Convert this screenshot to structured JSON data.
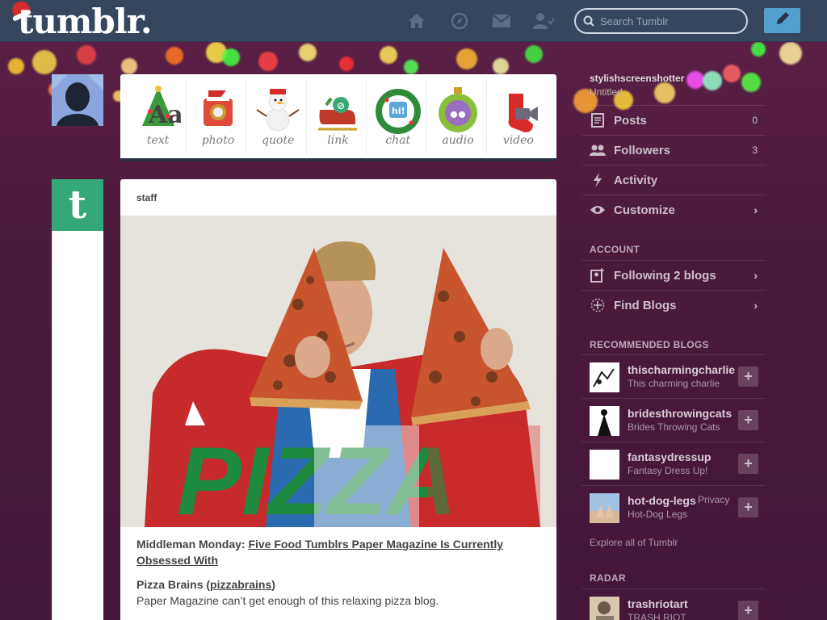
{
  "header": {
    "logo": "tumblr.",
    "search_placeholder": "Search Tumblr",
    "icons": [
      "home-icon",
      "explore-icon",
      "inbox-icon",
      "account-icon"
    ]
  },
  "composer": {
    "items": [
      {
        "label": "text",
        "icon": "christmas-tree-text-icon"
      },
      {
        "label": "photo",
        "icon": "santa-camera-icon"
      },
      {
        "label": "quote",
        "icon": "snowman-quote-icon"
      },
      {
        "label": "link",
        "icon": "sleigh-link-icon"
      },
      {
        "label": "chat",
        "icon": "wreath-chat-icon"
      },
      {
        "label": "audio",
        "icon": "ornament-audio-icon"
      },
      {
        "label": "video",
        "icon": "stocking-video-icon"
      }
    ]
  },
  "post": {
    "author": "staff",
    "image_text": "PIZZA",
    "headline_prefix": "Middleman Monday: ",
    "headline_link": "Five Food Tumblrs Paper Magazine Is Currently Obsessed With",
    "sub_title": "Pizza Brains (",
    "sub_link": "pizzabrains",
    "sub_close": ")",
    "sub_desc": "Paper Magazine can’t get enough of this relaxing pizza blog."
  },
  "sidebar": {
    "blog_name": "stylishscreenshotter",
    "blog_title": "Untitled",
    "rows": [
      {
        "label": "Posts",
        "count": "0"
      },
      {
        "label": "Followers",
        "count": "3"
      },
      {
        "label": "Activity",
        "count": ""
      },
      {
        "label": "Customize",
        "count": ""
      }
    ],
    "account_head": "ACCOUNT",
    "account_rows": [
      {
        "label": "Following 2 blogs"
      },
      {
        "label": "Find Blogs"
      }
    ],
    "recommended_head": "RECOMMENDED BLOGS",
    "recommended": [
      {
        "name": "thischarmingcharlie",
        "sub": "This charming charlie"
      },
      {
        "name": "bridesthrowingcats",
        "sub": "Brides Throwing Cats"
      },
      {
        "name": "fantasydressup",
        "sub": "Fantasy Dress Up!"
      },
      {
        "name": "hot-dog-legs",
        "sub": "Hot-Dog Legs"
      }
    ],
    "explore": "Explore all of Tumblr",
    "radar_head": "RADAR",
    "radar": [
      {
        "name": "trashriotart",
        "sub": "TRASH RIOT"
      }
    ],
    "privacy": "Privacy",
    "add_symbol": "+"
  },
  "colors": {
    "header_bg": "#36465d",
    "page_bg": "#4b1a3c",
    "compose_blue": "#529ecc",
    "staff_green": "#35a87a"
  }
}
